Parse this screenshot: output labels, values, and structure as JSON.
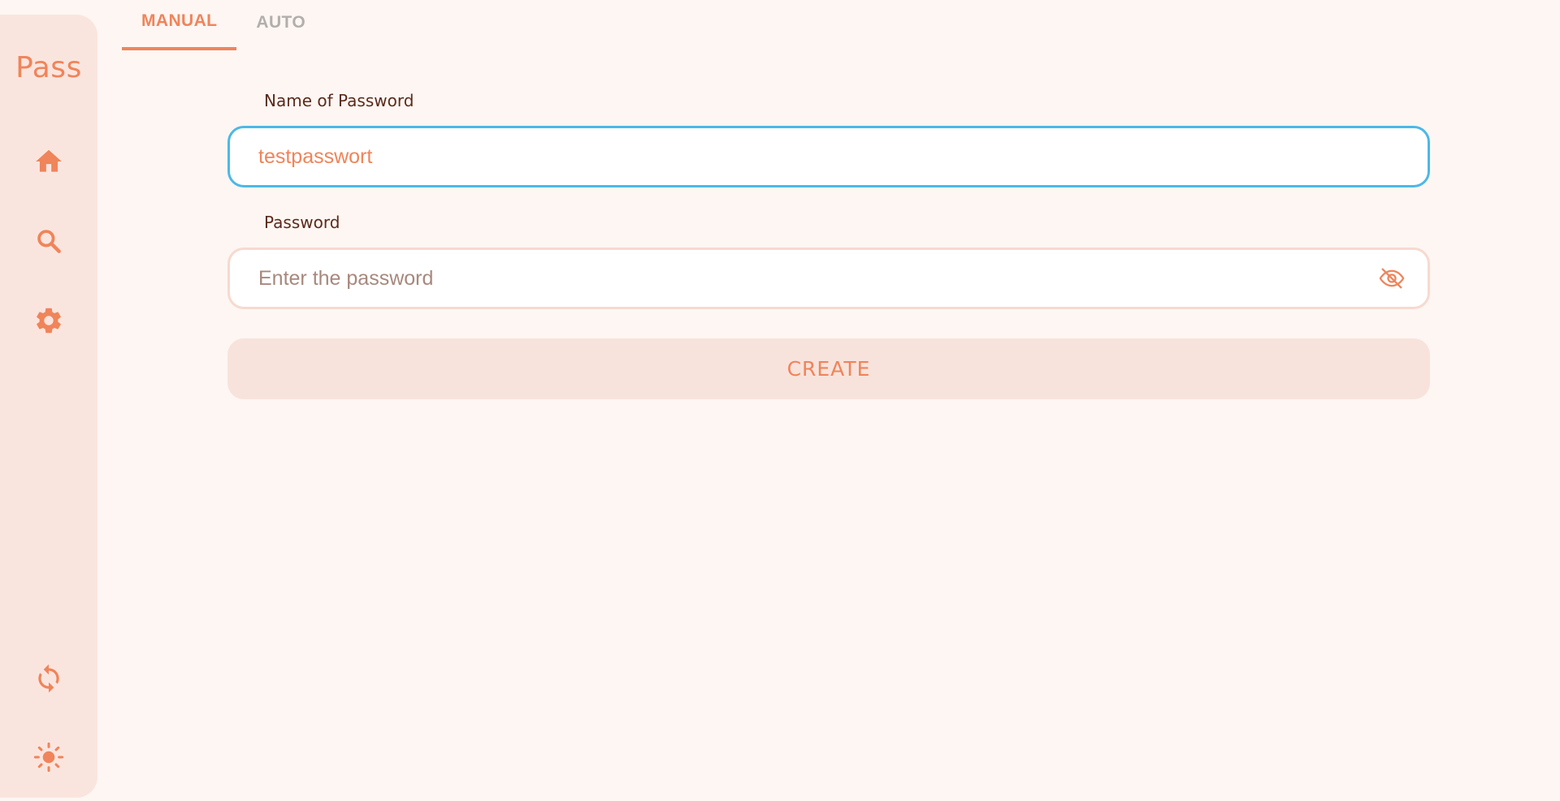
{
  "app": {
    "brand": "Pass"
  },
  "sidebar": {
    "items": [
      {
        "name": "home",
        "icon": "home-icon"
      },
      {
        "name": "search",
        "icon": "search-icon"
      },
      {
        "name": "settings",
        "icon": "gear-icon"
      },
      {
        "name": "sync",
        "icon": "sync-icon"
      },
      {
        "name": "theme",
        "icon": "sun-icon"
      }
    ]
  },
  "tabs": [
    {
      "label": "MANUAL",
      "active": true
    },
    {
      "label": "AUTO",
      "active": false
    }
  ],
  "form": {
    "name_label": "Name of Password",
    "name_value": "testpasswort",
    "password_label": "Password",
    "password_placeholder": "Enter the password",
    "visibility_icon": "eye-off-icon",
    "create_label": "CREATE"
  },
  "colors": {
    "accent": "#f0845a",
    "sidebar_bg": "#fae5de",
    "page_bg": "#fdf6f3",
    "focus_border": "#4cb8e8",
    "idle_border": "#f8d9cf",
    "label_text": "#5b2a1a",
    "inactive_tab": "#b3aeac"
  }
}
